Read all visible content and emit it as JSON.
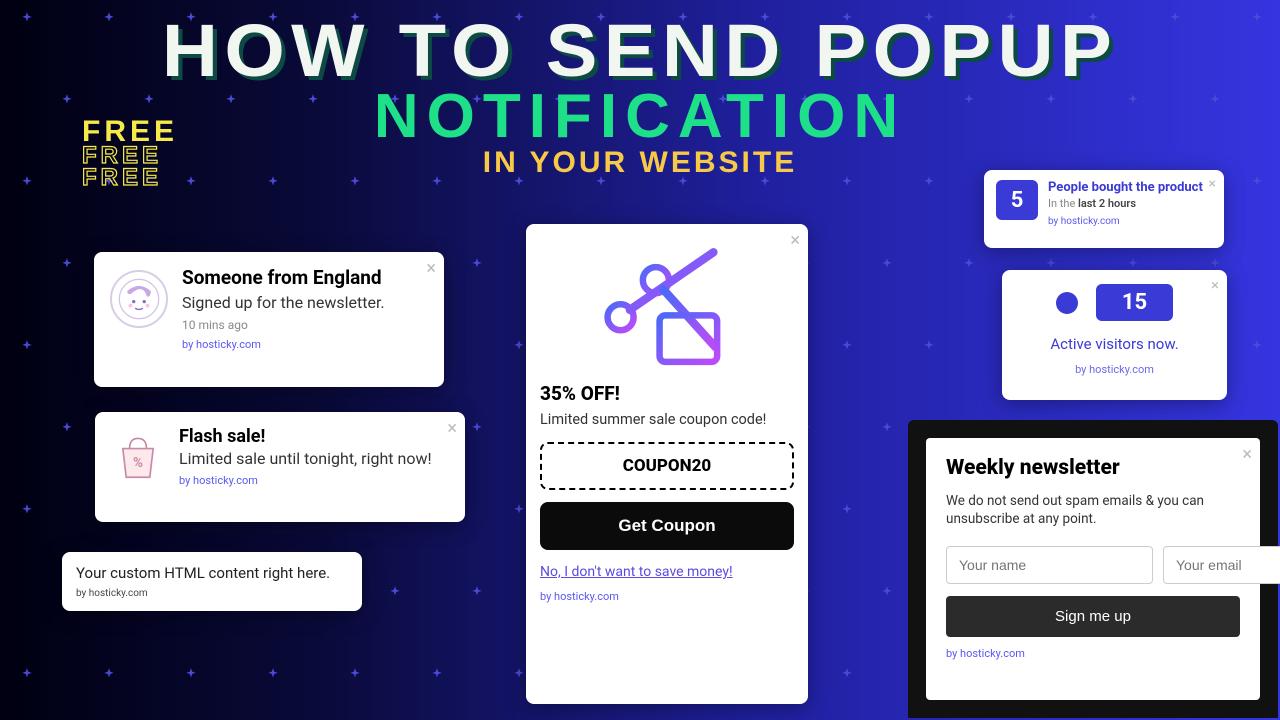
{
  "headline": {
    "l1": "HOW TO SEND POPUP",
    "l2": "NOTIFICATION",
    "l3": "IN YOUR WEBSITE"
  },
  "free_badge": "FREE",
  "byline": "by hosticky.com",
  "signup_card": {
    "title": "Someone from England",
    "subtitle": "Signed up for the newsletter.",
    "time": "10 mins ago"
  },
  "flash_card": {
    "title": "Flash sale!",
    "subtitle": "Limited sale until tonight, right now!"
  },
  "custom_card": {
    "body": "Your custom HTML content right here."
  },
  "coupon_card": {
    "title": "35% OFF!",
    "subtitle": "Limited summer sale coupon code!",
    "code": "COUPON20",
    "button": "Get Coupon",
    "decline": "No, I don't want to save money!"
  },
  "bought_card": {
    "count": "5",
    "title": "People bought the product",
    "sub_prefix": "In the ",
    "sub_bold": "last 2 hours"
  },
  "active_card": {
    "count": "15",
    "label": "Active visitors now."
  },
  "newsletter": {
    "title": "Weekly newsletter",
    "subtitle": "We do not send out spam emails & you can unsubscribe at any point.",
    "name_ph": "Your name",
    "email_ph": "Your email",
    "button": "Sign me up"
  }
}
